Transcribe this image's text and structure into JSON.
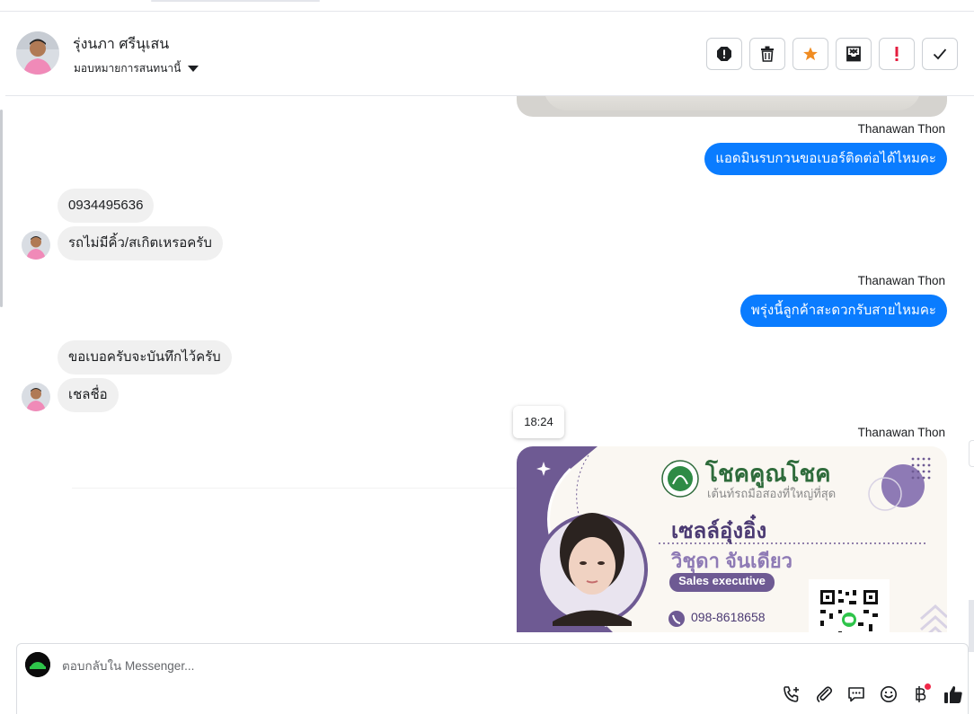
{
  "header": {
    "contact_name": "รุ่งนภา ศรีนุเสน",
    "assign_label": "มอบหมายการสนทนานี้"
  },
  "toolbar": {
    "actions": [
      "spam-icon",
      "trash-icon",
      "star-icon",
      "archive-icon",
      "exclamation-icon",
      "check-icon"
    ],
    "star_color": "#f08c22",
    "alert_color": "#e41e3f"
  },
  "messages": [
    {
      "direction": "out",
      "sender": "Thanawan Thon",
      "text": "แอดมินรบกวนขอเบอร์ติดต่อได้ไหมคะ"
    },
    {
      "direction": "in",
      "text": "0934495636"
    },
    {
      "direction": "in",
      "text": "รถไม่มีคิ้ว/สเกิตเหรอครับ"
    },
    {
      "direction": "out",
      "sender": "Thanawan Thon",
      "text": "พรุ่งนี้ลูกค้าสะดวกรับสายไหมคะ"
    },
    {
      "direction": "in",
      "text": "ขอเบอครับจะบันทึกไว้ครับ"
    },
    {
      "direction": "in",
      "text": "เชลชื่อ"
    },
    {
      "direction": "out",
      "sender": "Thanawan Thon",
      "type": "image"
    }
  ],
  "tooltip_time": "18:24",
  "business_card": {
    "brand": "โชคคูณโชค",
    "tagline": "เต้นท์รถมือสองที่ใหญ่ที่สุด",
    "nickname": "เซลล์อุ๋งอิ๋ง",
    "full_name": "วิชุดา จันเดียว",
    "role": "Sales executive",
    "phone": "098-8618658",
    "accent_color": "#6e5a93"
  },
  "composer": {
    "placeholder": "ตอบกลับใน Messenger...",
    "tools": [
      "phone-plus-icon",
      "paperclip-icon",
      "saved-reply-icon",
      "emoji-icon",
      "baht-icon",
      "like-icon"
    ],
    "send_color": "#1877f2"
  }
}
